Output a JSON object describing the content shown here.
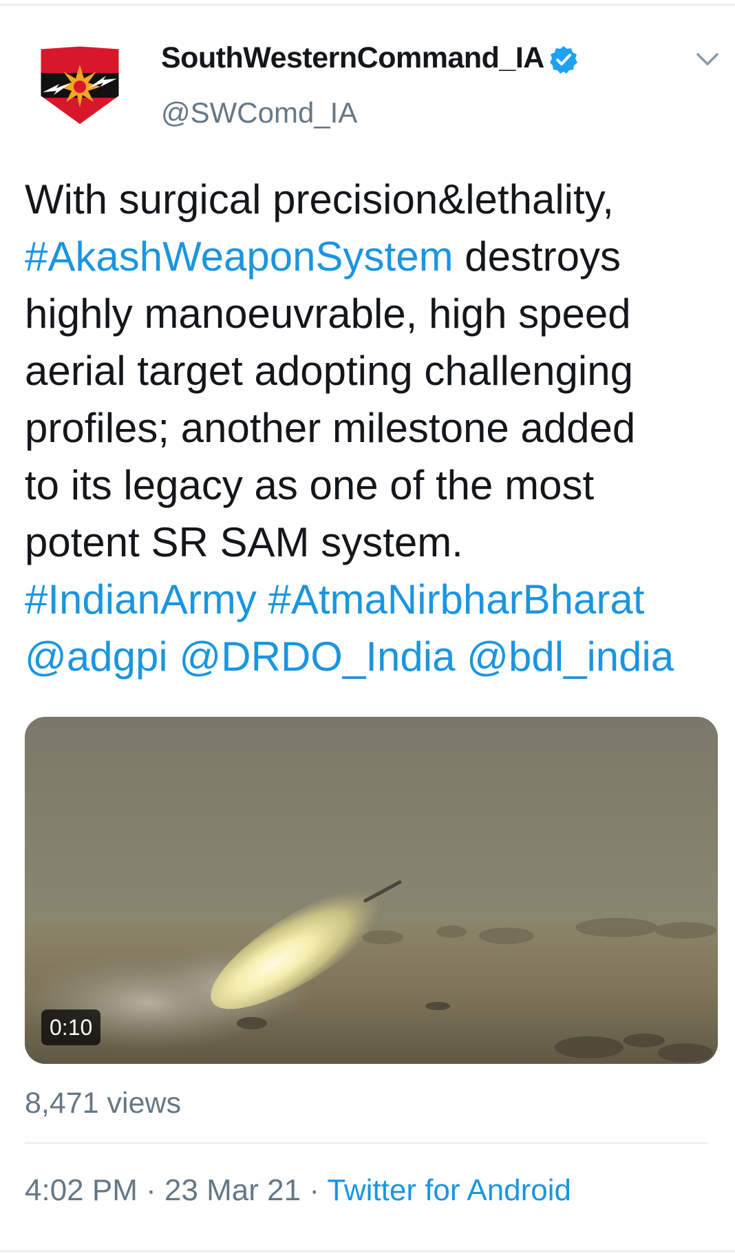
{
  "author": {
    "display_name": "SouthWesternCommand_IA",
    "handle": "@SWComd_IA",
    "verified": true,
    "avatar_icon": "army-command-emblem-icon"
  },
  "tweet": {
    "lines": [
      [
        {
          "text": "With surgical precision&lethality,",
          "type": "text"
        }
      ],
      [
        {
          "text": "#AkashWeaponSystem",
          "type": "hashtag"
        },
        {
          "text": " destroys",
          "type": "text"
        }
      ],
      [
        {
          "text": "highly manoeuvrable, high speed",
          "type": "text"
        }
      ],
      [
        {
          "text": "aerial target adopting challenging",
          "type": "text"
        }
      ],
      [
        {
          "text": "profiles; another milestone added",
          "type": "text"
        }
      ],
      [
        {
          "text": "to its legacy as one of the most",
          "type": "text"
        }
      ],
      [
        {
          "text": "potent SR SAM system.",
          "type": "text"
        }
      ],
      [
        {
          "text": "#IndianArmy",
          "type": "hashtag"
        },
        {
          "text": " ",
          "type": "text"
        },
        {
          "text": "#AtmaNirbharBharat",
          "type": "hashtag"
        }
      ],
      [
        {
          "text": "@adgpi",
          "type": "mention"
        },
        {
          "text": " ",
          "type": "text"
        },
        {
          "text": "@DRDO_India",
          "type": "mention"
        },
        {
          "text": " ",
          "type": "text"
        },
        {
          "text": "@bdl_india",
          "type": "mention"
        }
      ]
    ]
  },
  "media": {
    "type": "video",
    "duration": "0:10",
    "description_icon": "missile-launch-video-thumbnail"
  },
  "stats": {
    "views": "8,471 views"
  },
  "meta": {
    "time": "4:02 PM",
    "separator": " · ",
    "date": "23 Mar 21",
    "source": "Twitter for Android"
  },
  "colors": {
    "link": "#1b95e0",
    "text": "#14171a",
    "secondary": "#657786",
    "divider": "#e6ecf0",
    "verified": "#1da1f2"
  }
}
